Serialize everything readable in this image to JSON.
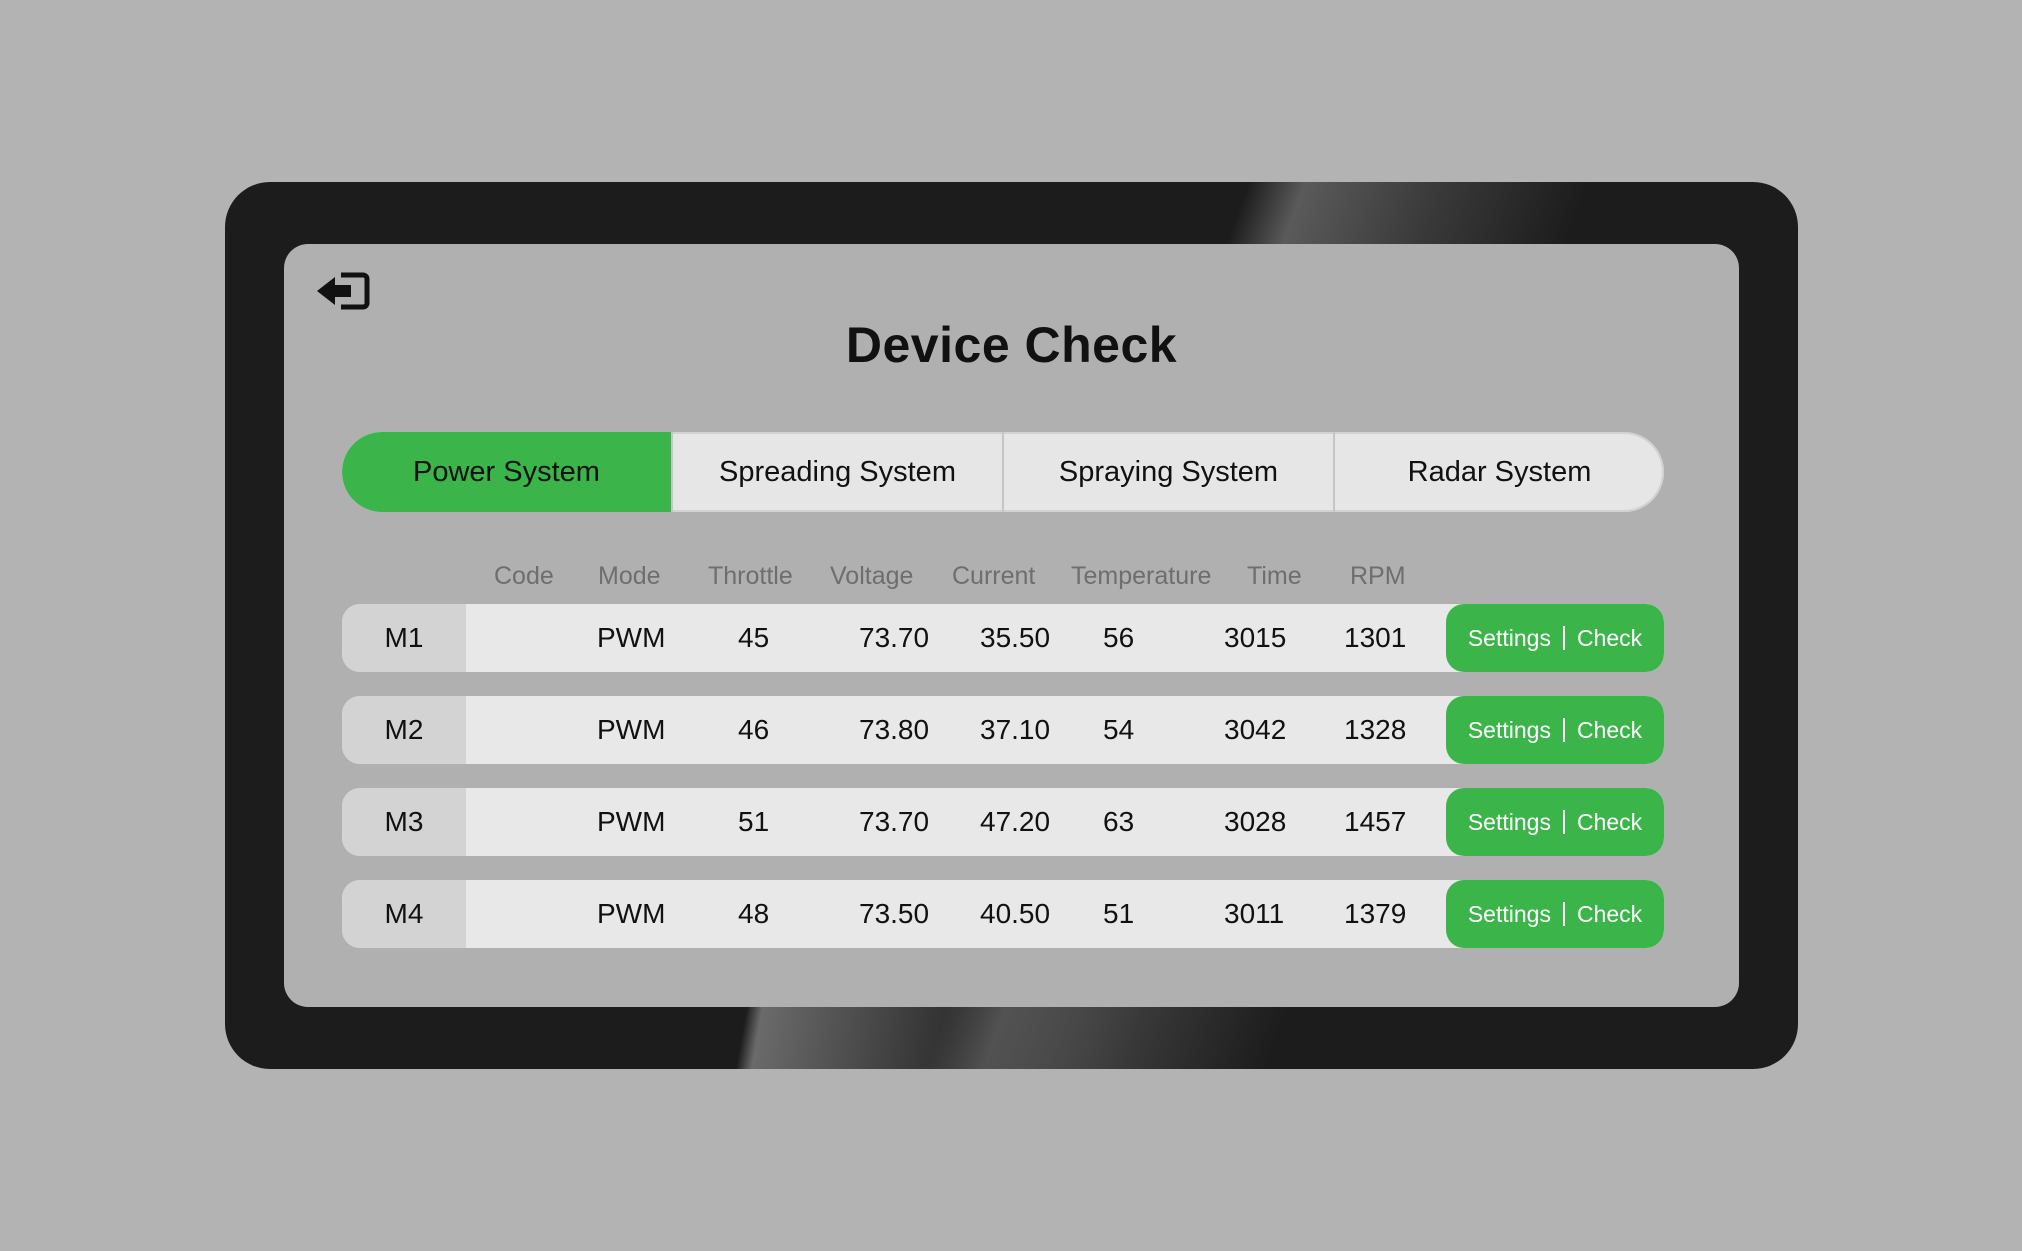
{
  "title": "Device Check",
  "icons": {
    "back": "back-exit-icon"
  },
  "colors": {
    "accent": "#3bb54a",
    "page_background": "#b3b3b3",
    "frame": "#1c1c1c",
    "screen": "#b0b0b0"
  },
  "tabs": [
    {
      "label": "Power System",
      "active": true
    },
    {
      "label": "Spreading System",
      "active": false
    },
    {
      "label": "Spraying System",
      "active": false
    },
    {
      "label": "Radar System",
      "active": false
    }
  ],
  "table": {
    "headers": {
      "code": "Code",
      "mode": "Mode",
      "throttle": "Throttle",
      "voltage": "Voltage",
      "current": "Current",
      "temperature": "Temperature",
      "time": "Time",
      "rpm": "RPM"
    },
    "rows": [
      {
        "id": "M1",
        "mode": "PWM",
        "throttle": "45",
        "voltage": "73.70",
        "current": "35.50",
        "temperature": "56",
        "time": "3015",
        "rpm": "1301",
        "settings_label": "Settings",
        "check_label": "Check"
      },
      {
        "id": "M2",
        "mode": "PWM",
        "throttle": "46",
        "voltage": "73.80",
        "current": "37.10",
        "temperature": "54",
        "time": "3042",
        "rpm": "1328",
        "settings_label": "Settings",
        "check_label": "Check"
      },
      {
        "id": "M3",
        "mode": "PWM",
        "throttle": "51",
        "voltage": "73.70",
        "current": "47.20",
        "temperature": "63",
        "time": "3028",
        "rpm": "1457",
        "settings_label": "Settings",
        "check_label": "Check"
      },
      {
        "id": "M4",
        "mode": "PWM",
        "throttle": "48",
        "voltage": "73.50",
        "current": "40.50",
        "temperature": "51",
        "time": "3011",
        "rpm": "1379",
        "settings_label": "Settings",
        "check_label": "Check"
      }
    ]
  }
}
